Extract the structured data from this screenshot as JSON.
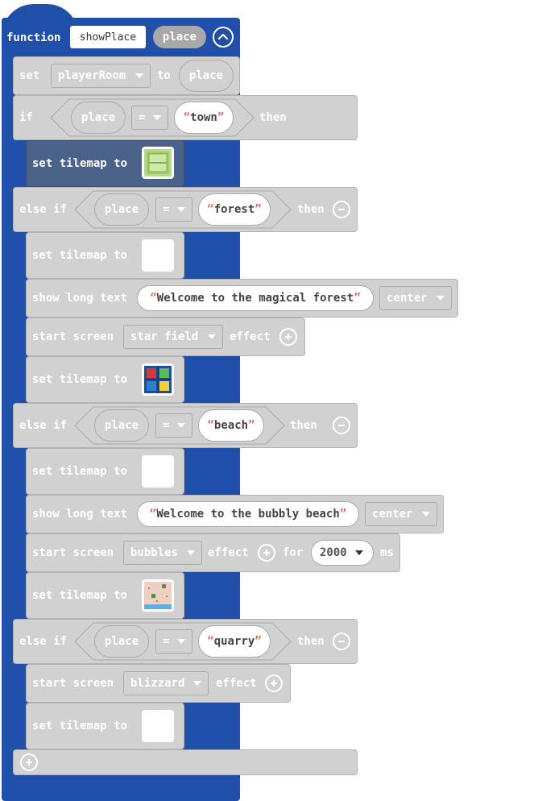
{
  "function": {
    "keyword": "function",
    "name": "showPlace",
    "param": "place"
  },
  "set_var": {
    "set": "set",
    "variable": "playerRoom",
    "to": "to",
    "value": "place"
  },
  "if_block": {
    "if": "if",
    "param": "place",
    "op": "=",
    "value": "town",
    "then": "then",
    "tilemap_label": "set tilemap to"
  },
  "else_forest": {
    "else_if": "else if",
    "param": "place",
    "op": "=",
    "value": "forest",
    "then": "then",
    "tilemap1_label": "set tilemap to",
    "text_label": "show long text",
    "text_value": "Welcome to the magical forest",
    "text_align": "center",
    "effect_label": "start screen",
    "effect_value": "star field",
    "effect_suffix": "effect",
    "tilemap2_label": "set tilemap to"
  },
  "else_beach": {
    "else_if": "else if",
    "param": "place",
    "op": "=",
    "value": "beach",
    "then": "then",
    "tilemap1_label": "set tilemap to",
    "text_label": "show long text",
    "text_value": "Welcome to the bubbly beach",
    "text_align": "center",
    "effect_label": "start screen",
    "effect_value": "bubbles",
    "effect_suffix": "effect",
    "for_label": "for",
    "duration": "2000",
    "ms": "ms",
    "tilemap2_label": "set tilemap to"
  },
  "else_quarry": {
    "else_if": "else if",
    "param": "place",
    "op": "=",
    "value": "quarry",
    "then": "then",
    "effect_label": "start screen",
    "effect_value": "blizzard",
    "effect_suffix": "effect",
    "tilemap_label": "set tilemap to"
  },
  "colors": {
    "function_blue": "#1f4fa8",
    "block_grey": "#d1d1d1",
    "selected_block": "#4a6189",
    "quote_red": "#d87060"
  }
}
